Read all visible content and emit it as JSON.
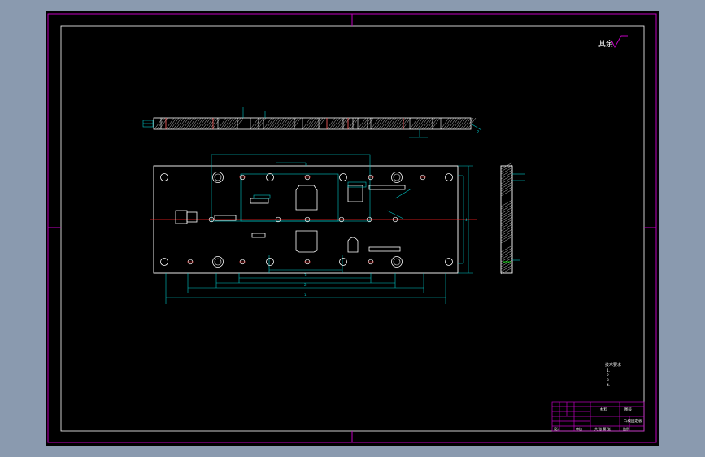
{
  "viewport": {
    "background": "#000000",
    "frame_color": "#c000c0"
  },
  "colors": {
    "outline": "#ffffff",
    "dimension": "#00c8c8",
    "centerline": "#ff2020",
    "hatch": "#c0c0c0",
    "accent_green": "#00ff00",
    "title_block": "#c000c0"
  },
  "surface_finish": {
    "label": "其余",
    "symbol": "surface-roughness-icon"
  },
  "side_view": {
    "dimension_label": "2"
  },
  "plan_view": {
    "dimension_labels": [
      "1",
      "2",
      "3",
      "4"
    ]
  },
  "notes": {
    "title": "技术要求",
    "lines": [
      "1.",
      "2.",
      "3.",
      "4."
    ]
  },
  "title_block": {
    "part_name": "凸模固定板",
    "drawing_no": "图号",
    "material": "材料",
    "scale_label": "比例",
    "sheet_label": "共 张 第 张",
    "designer": "设计",
    "checker": "审核"
  }
}
